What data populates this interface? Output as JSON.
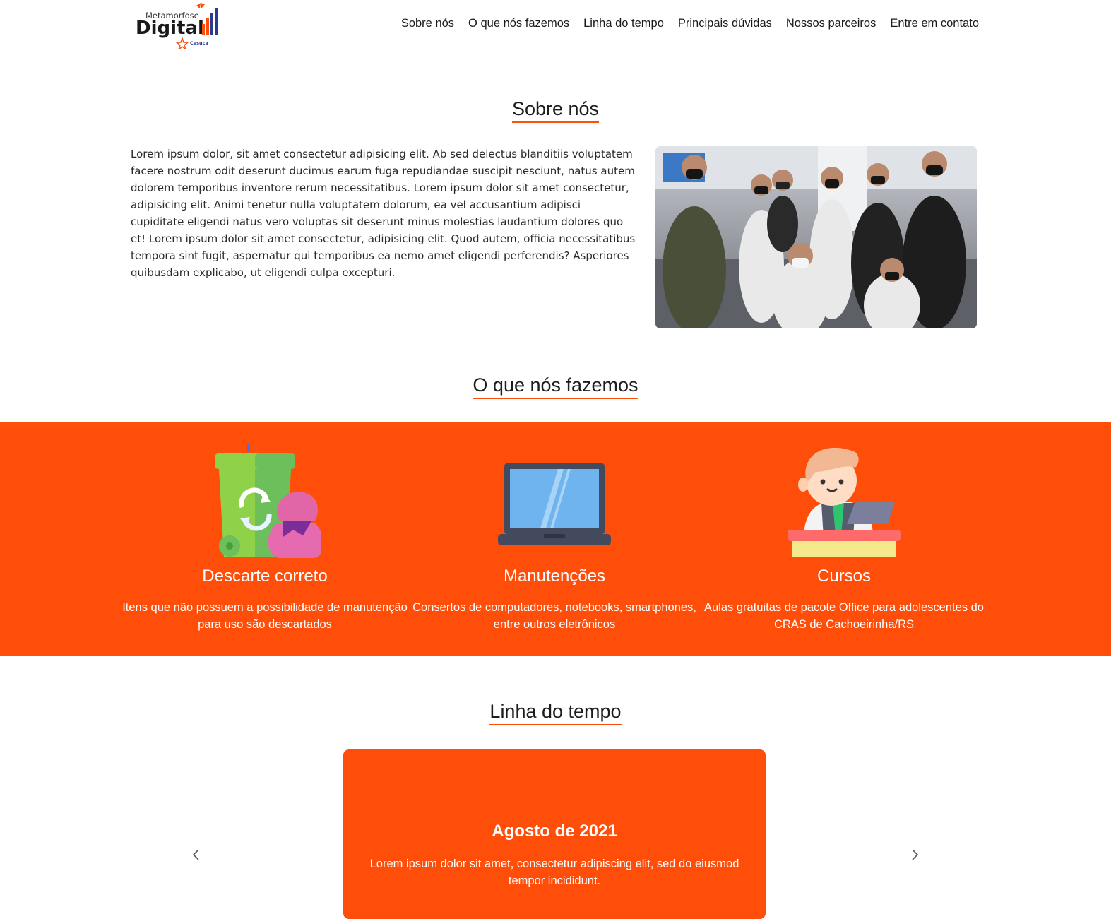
{
  "header": {
    "logo": {
      "word_top": "Metamorfose",
      "word_main": "Digital",
      "partner": "Cesuca"
    },
    "nav": [
      "Sobre nós",
      "O que nós fazemos",
      "Linha do tempo",
      "Principais dúvidas",
      "Nossos parceiros",
      "Entre em contato"
    ]
  },
  "about": {
    "title": "Sobre nós",
    "text": "Lorem ipsum dolor, sit amet consectetur adipisicing elit. Ab sed delectus blanditiis voluptatem facere nostrum odit deserunt ducimus earum fuga repudiandae suscipit nesciunt, natus autem dolorem temporibus inventore rerum necessitatibus. Lorem ipsum dolor sit amet consectetur, adipisicing elit. Animi tenetur nulla voluptatem dolorum, ea vel accusantium adipisci cupiditate eligendi natus vero voluptas sit deserunt minus molestias laudantium dolores quo et! Lorem ipsum dolor sit amet consectetur, adipisicing elit. Quod autem, officia necessitatibus tempora sint fugit, aspernatur qui temporibus ea nemo amet eligendi perferendis? Asperiores quibusdam explicabo, ut eligendi culpa excepturi."
  },
  "services": {
    "title": "O que nós fazemos",
    "items": [
      {
        "icon": "recycle-bin-icon",
        "title": "Descarte correto",
        "desc": "Itens que não possuem a possibilidade de manutenção para uso são descartados"
      },
      {
        "icon": "laptop-icon",
        "title": "Manutenções",
        "desc": "Consertos de computadores, notebooks, smartphones, entre outros eletrônicos"
      },
      {
        "icon": "student-at-desk-icon",
        "title": "Cursos",
        "desc": "Aulas gratuitas de pacote Office para adolescentes do CRAS de Cachoeirinha/RS"
      }
    ]
  },
  "timeline": {
    "title": "Linha do tempo",
    "date": "Agosto de 2021",
    "text": "Lorem ipsum dolor sit amet, consectetur adipiscing elit, sed do eiusmod tempor incididunt."
  },
  "colors": {
    "accent": "#ff4d0a",
    "text": "#1d1d1d",
    "background": "#ffffff"
  }
}
